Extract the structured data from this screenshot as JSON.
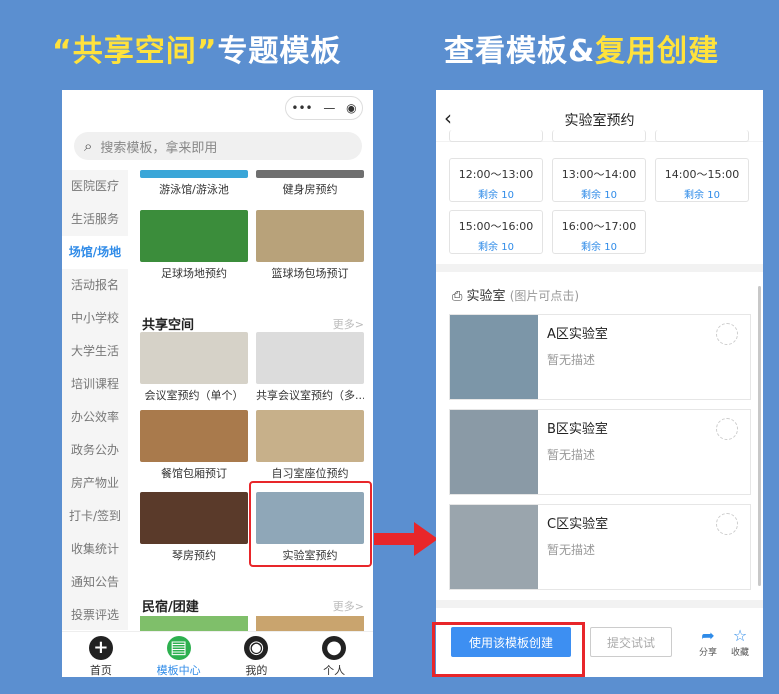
{
  "headlines": {
    "left_quote_open": "“",
    "left_highlight": "共享空间",
    "left_quote_close": "”",
    "left_rest": "专题模板",
    "right_main": "查看模板&",
    "right_highlight": "复用创建"
  },
  "left_phone": {
    "capsule": {
      "menu": "•••",
      "minimize": "—",
      "close": "◉"
    },
    "search_placeholder": "搜索模板，拿来即用",
    "sidebar": [
      "医院医疗",
      "生活服务",
      "场馆/场地",
      "活动报名",
      "中小学校",
      "大学生活",
      "培训课程",
      "办公效率",
      "政务公办",
      "房产物业",
      "打卡/签到",
      "收集统计",
      "通知公告",
      "投票评选"
    ],
    "sidebar_active_index": 2,
    "top_tiles": [
      {
        "caption": "游泳馆/游泳池",
        "color": "#3aa6d8"
      },
      {
        "caption": "健身房预约",
        "color": "#6f6f6f"
      },
      {
        "caption": "足球场地预约",
        "color": "#3b8d3b"
      },
      {
        "caption": "篮球场包场预订",
        "color": "#b8a27a"
      }
    ],
    "section_shared": {
      "title": "共享空间",
      "more": "更多>"
    },
    "shared_tiles": [
      {
        "caption": "会议室预约（单个）",
        "color": "#d6d2c8"
      },
      {
        "caption": "共享会议室预约（多...",
        "color": "#dcdcdc"
      },
      {
        "caption": "餐馆包厢预订",
        "color": "#a97a4c"
      },
      {
        "caption": "自习室座位预约",
        "color": "#c7b08a"
      },
      {
        "caption": "琴房预约",
        "color": "#5a3a2a"
      },
      {
        "caption": "实验室预约",
        "color": "#8fa7b8"
      }
    ],
    "section_lodging": {
      "title": "民宿/团建",
      "more": "更多>"
    },
    "tabbar": [
      {
        "label": "首页",
        "icon": "plus-icon",
        "glyph": "+"
      },
      {
        "label": "模板中心",
        "icon": "template-icon",
        "glyph": "▤"
      },
      {
        "label": "我的",
        "icon": "eye-icon",
        "glyph": "◉"
      },
      {
        "label": "个人",
        "icon": "user-icon",
        "glyph": "●"
      }
    ],
    "tabbar_active_index": 1
  },
  "right_phone": {
    "title": "实验室预约",
    "time_slots": [
      {
        "time": "12:00～13:00",
        "remain": "剩余 10"
      },
      {
        "time": "13:00～14:00",
        "remain": "剩余 10"
      },
      {
        "time": "14:00～15:00",
        "remain": "剩余 10"
      },
      {
        "time": "15:00～16:00",
        "remain": "剩余 10"
      },
      {
        "time": "16:00～17:00",
        "remain": "剩余 10"
      }
    ],
    "lab_section": {
      "title": "实验室",
      "subtitle": "(图片可点击)"
    },
    "labs": [
      {
        "name": "A区实验室",
        "desc": "暂无描述",
        "color": "#7c96a8"
      },
      {
        "name": "B区实验室",
        "desc": "暂无描述",
        "color": "#8a9aa6"
      },
      {
        "name": "C区实验室",
        "desc": "暂无描述",
        "color": "#9aa5ad"
      }
    ],
    "use_button": "使用该模板创建",
    "try_button": "提交试试",
    "share_label": "分享",
    "collect_label": "收藏"
  },
  "colors": {
    "accent": "#2f8be8",
    "highlight": "#ffe23c",
    "alert_red": "#e8262a",
    "background": "#5b8fd0"
  }
}
